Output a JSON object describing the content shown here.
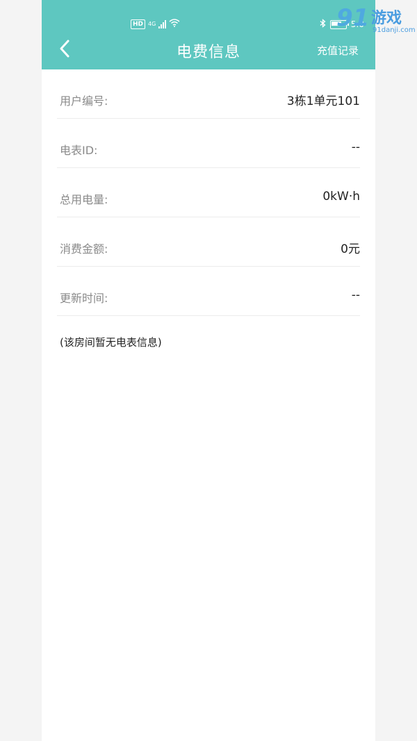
{
  "status_bar": {
    "hd_badge": "HD",
    "network": "4G",
    "time": "5:0"
  },
  "header": {
    "title": "电费信息",
    "action_label": "充值记录"
  },
  "rows": [
    {
      "label": "用户编号:",
      "value": "3栋1单元101"
    },
    {
      "label": "电表ID:",
      "value": "--"
    },
    {
      "label": "总用电量:",
      "value": "0kW·h"
    },
    {
      "label": "消费金额:",
      "value": "0元"
    },
    {
      "label": "更新时间:",
      "value": "--"
    }
  ],
  "note": "(该房间暂无电表信息)",
  "watermark": {
    "logo": "91",
    "name": "游戏",
    "site": "91danji.com"
  },
  "colors": {
    "header_bg": "#5ec7c0",
    "watermark": "#4a9de0"
  }
}
